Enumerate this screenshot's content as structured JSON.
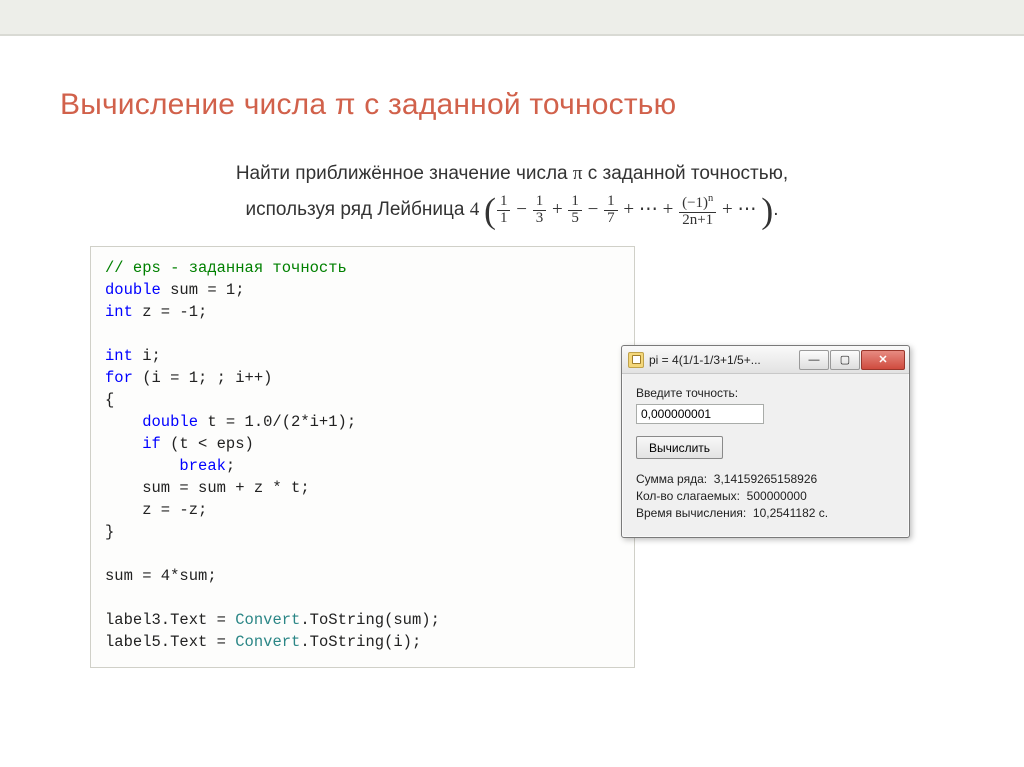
{
  "title": "Вычисление числа π с заданной точностью",
  "task": {
    "line1_pre": "Найти приближённое значение числа ",
    "line1_pi": "π",
    "line1_post": " с заданной точностью,",
    "line2_pre": "используя ряд Лейбница ",
    "coef": "4",
    "f1n": "1",
    "f1d": "1",
    "f2n": "1",
    "f2d": "3",
    "f3n": "1",
    "f3d": "5",
    "f4n": "1",
    "f4d": "7",
    "fnn": "(−1)",
    "fne": "n",
    "fnd": "2n+1",
    "ell": "⋯",
    "tail": "."
  },
  "code": {
    "comment": "// eps - заданная точность",
    "l1a": "double",
    "l1b": " sum = 1;",
    "l2a": "int",
    "l2b": " z = -1;",
    "l3a": "int",
    "l3b": " i;",
    "l4a": "for",
    "l4b": " (i = 1; ; i++)",
    "brace_open": "{",
    "l5a": "    double",
    "l5b": " t = 1.0/(2*i+1);",
    "l6a": "    if",
    "l6b": " (t < eps)",
    "l7a": "        break",
    "l7b": ";",
    "l8": "    sum = sum + z * t;",
    "l9": "    z = -z;",
    "brace_close": "}",
    "l10": "sum = 4*sum;",
    "l11a": "label3.Text = ",
    "l11b": "Convert",
    "l11c": ".ToString(sum);",
    "l12a": "label5.Text = ",
    "l12b": "Convert",
    "l12c": ".ToString(i);"
  },
  "dialog": {
    "title": "pi = 4(1/1-1/3+1/5+...",
    "label_precision": "Введите точность:",
    "precision_value": "0,000000001",
    "button": "Вычислить",
    "sum_label": "Сумма ряда:",
    "sum_value": "3,14159265158926",
    "count_label": "Кол-во слагаемых:",
    "count_value": "500000000",
    "time_label": "Время вычисления:",
    "time_value": "10,2541182 с."
  }
}
